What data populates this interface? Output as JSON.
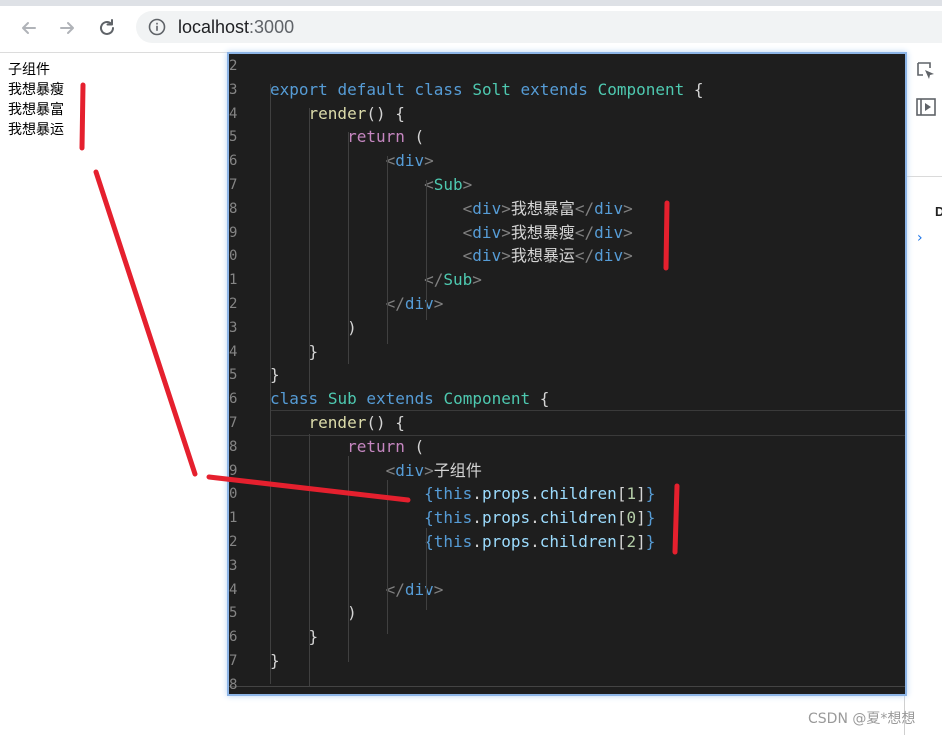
{
  "browser": {
    "url_host": "localhost",
    "url_port": ":3000"
  },
  "page": {
    "lines": [
      "子组件",
      "我想暴瘦",
      "我想暴富",
      "我想暴运"
    ]
  },
  "devtools": {
    "partial_label": "D",
    "expand_glyph": "›"
  },
  "editor": {
    "line_numbers": [
      "2",
      "3",
      "4",
      "5",
      "6",
      "7",
      "8",
      "9",
      "0",
      "1",
      "2",
      "3",
      "4",
      "5",
      "6",
      "7",
      "8",
      "9",
      "0",
      "1",
      "2",
      "3",
      "4",
      "5",
      "6",
      "7",
      "8"
    ],
    "code_lines": [
      "",
      "export default class Solt extends Component {",
      "    render() {",
      "        return (",
      "            <div>",
      "                <Sub>",
      "                    <div>我想暴富</div>",
      "                    <div>我想暴瘦</div>",
      "                    <div>我想暴运</div>",
      "                </Sub>",
      "            </div>",
      "        )",
      "    }",
      "}",
      "class Sub extends Component {",
      "    render() {",
      "        return (",
      "            <div>子组件",
      "                {this.props.children[1]}",
      "                {this.props.children[0]}",
      "                {this.props.children[2]}",
      "",
      "            </div>",
      "        )",
      "    }",
      "}",
      ""
    ]
  },
  "watermark": "CSDN @夏*想想",
  "colors": {
    "editor_bg": "#1e1e1e",
    "keyword": "#569cd6",
    "control": "#c586c0",
    "class_name": "#4ec9b0",
    "function": "#dcdcaa",
    "property": "#9cdcfe",
    "number": "#b5cea8",
    "annotation_red": "#e5202e"
  },
  "icons": [
    "back-arrow-icon",
    "forward-arrow-icon",
    "reload-icon",
    "info-icon",
    "inspect-element-icon",
    "device-toolbar-icon"
  ]
}
